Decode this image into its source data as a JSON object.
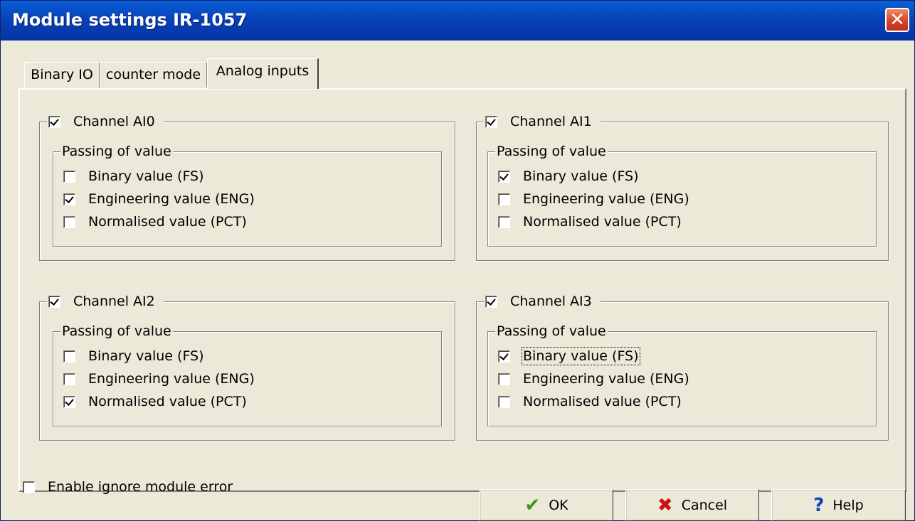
{
  "window": {
    "title": "Module settings IR-1057",
    "close_glyph": "✕"
  },
  "tabs": [
    {
      "label": "Binary IO",
      "active": false
    },
    {
      "label": "counter mode",
      "active": false
    },
    {
      "label": "Analog inputs",
      "active": true
    }
  ],
  "channels": [
    {
      "label": "Channel AI0",
      "enabled": true,
      "group_title": "Passing of value",
      "options": [
        {
          "label": "Binary value (FS)",
          "checked": false
        },
        {
          "label": "Engineering value (ENG)",
          "checked": true
        },
        {
          "label": "Normalised value (PCT)",
          "checked": false
        }
      ]
    },
    {
      "label": "Channel AI1",
      "enabled": true,
      "group_title": "Passing of value",
      "options": [
        {
          "label": "Binary value (FS)",
          "checked": true
        },
        {
          "label": "Engineering value (ENG)",
          "checked": false
        },
        {
          "label": "Normalised value (PCT)",
          "checked": false
        }
      ]
    },
    {
      "label": "Channel AI2",
      "enabled": true,
      "group_title": "Passing of value",
      "options": [
        {
          "label": "Binary value (FS)",
          "checked": false
        },
        {
          "label": "Engineering value (ENG)",
          "checked": false
        },
        {
          "label": "Normalised value (PCT)",
          "checked": true
        }
      ]
    },
    {
      "label": "Channel AI3",
      "enabled": true,
      "group_title": "Passing of value",
      "options": [
        {
          "label": "Binary value (FS)",
          "checked": true,
          "focused": true
        },
        {
          "label": "Engineering value (ENG)",
          "checked": false
        },
        {
          "label": "Normalised value (PCT)",
          "checked": false
        }
      ]
    }
  ],
  "footer": {
    "ignore_error": {
      "label": "Enable ignore module error",
      "checked": false
    },
    "ok": {
      "label": "OK",
      "icon": "checkmark-icon",
      "color": "#2f9a1f"
    },
    "cancel": {
      "label": "Cancel",
      "icon": "red-x-icon",
      "color": "#d01010"
    },
    "help": {
      "label": "Help",
      "icon": "question-icon",
      "color": "#1040c0"
    }
  }
}
